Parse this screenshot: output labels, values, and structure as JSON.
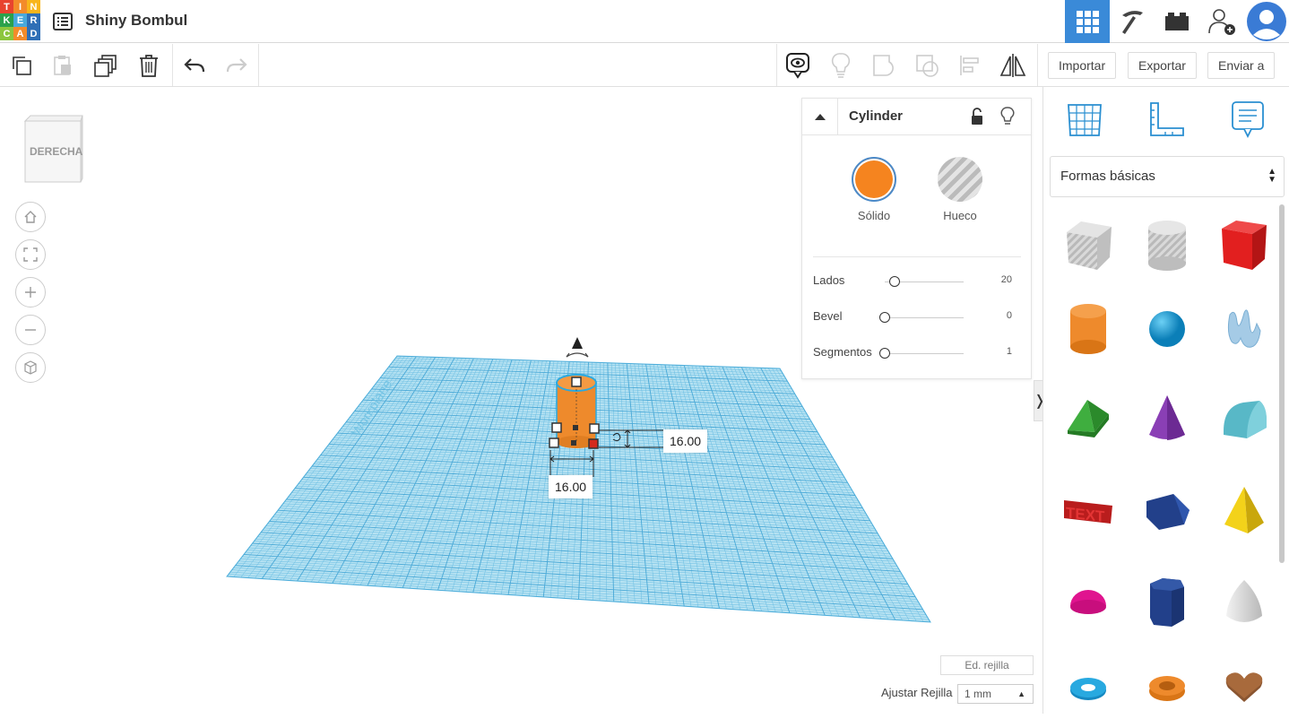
{
  "logo": {
    "letters": [
      "T",
      "I",
      "N",
      "K",
      "E",
      "R",
      "C",
      "A",
      "D"
    ],
    "colors": [
      "#e8432f",
      "#f38b2a",
      "#f8b51c",
      "#2ba14c",
      "#49a9db",
      "#2f6fb6",
      "#8cc63e",
      "#f38b2a",
      "#2f6fb6"
    ]
  },
  "header": {
    "title": "Shiny Bombul",
    "menu_icon": "list-icon"
  },
  "top_nav": {
    "items": [
      "grid-view-icon",
      "pickaxe-icon",
      "brick-icon",
      "add-user-icon",
      "avatar"
    ],
    "active": "grid-view-icon",
    "accent": "#3a8ad8"
  },
  "toolbar": {
    "left_icons": [
      "copy-icon",
      "paste-icon",
      "duplicate-icon",
      "delete-icon",
      "undo-icon",
      "redo-icon"
    ],
    "right_icons": [
      "notes-visibility-icon",
      "light-bulb-icon",
      "group-icon",
      "ungroup-icon",
      "align-icon",
      "mirror-icon"
    ],
    "import_label": "Importar",
    "export_label": "Exportar",
    "send_label": "Enviar a"
  },
  "viewcube": {
    "face_label": "DERECHA"
  },
  "nav_controls": [
    "home-icon",
    "fit-icon",
    "zoom-in-icon",
    "zoom-out-icon",
    "perspective-icon"
  ],
  "workplane": {
    "plate_color": "#a8dcef",
    "grid_color": "#5bb6df",
    "object_color": "#ee8a2c",
    "dim_width": "16.00",
    "dim_depth": "16.00"
  },
  "inspector": {
    "title": "Cylinder",
    "solid_label": "Sólido",
    "hole_label": "Hueco",
    "solid_color": "#f5841f",
    "properties": [
      {
        "name": "Lados",
        "value": "20",
        "fraction": 0.13
      },
      {
        "name": "Bevel",
        "value": "0",
        "fraction": 0.0
      },
      {
        "name": "Segmentos",
        "value": "1",
        "fraction": 0.0
      }
    ]
  },
  "shapes_panel": {
    "tools": [
      "workplane-icon",
      "ruler-icon",
      "notes-icon"
    ],
    "category": "Formas básicas",
    "shapes": [
      "striped-box",
      "striped-cylinder",
      "red-box",
      "orange-cylinder",
      "blue-sphere",
      "scribble",
      "green-roof",
      "purple-cone",
      "teal-round-roof",
      "red-text",
      "navy-polygon",
      "yellow-pyramid",
      "pink-half-sphere",
      "navy-hexagonal-prism",
      "white-paraboloid",
      "blue-torus",
      "orange-tube",
      "brown-heart"
    ]
  },
  "footer": {
    "edit_grid_label": "Ed. rejilla",
    "snap_label": "Ajustar Rejilla",
    "snap_value": "1 mm"
  }
}
